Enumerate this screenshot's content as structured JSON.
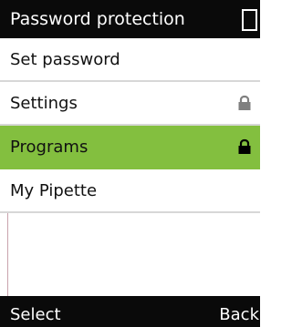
{
  "header": {
    "title": "Password protection",
    "status_icon": "battery-icon"
  },
  "menu": {
    "items": [
      {
        "label": "Set password",
        "selected": false,
        "lock_icon": ""
      },
      {
        "label": "Settings",
        "selected": false,
        "lock_icon": "lock-icon"
      },
      {
        "label": "Programs",
        "selected": true,
        "lock_icon": "lock-icon"
      },
      {
        "label": "My Pipette",
        "selected": false,
        "lock_icon": ""
      }
    ]
  },
  "softkeys": {
    "left": "Select",
    "right": "Back"
  },
  "colors": {
    "header_background": "#0a0a0a",
    "selected_row": "#83bf3f",
    "lock_muted": "#7f7f7f",
    "lock_selected": "#000000",
    "divider": "#d7d7d7"
  }
}
